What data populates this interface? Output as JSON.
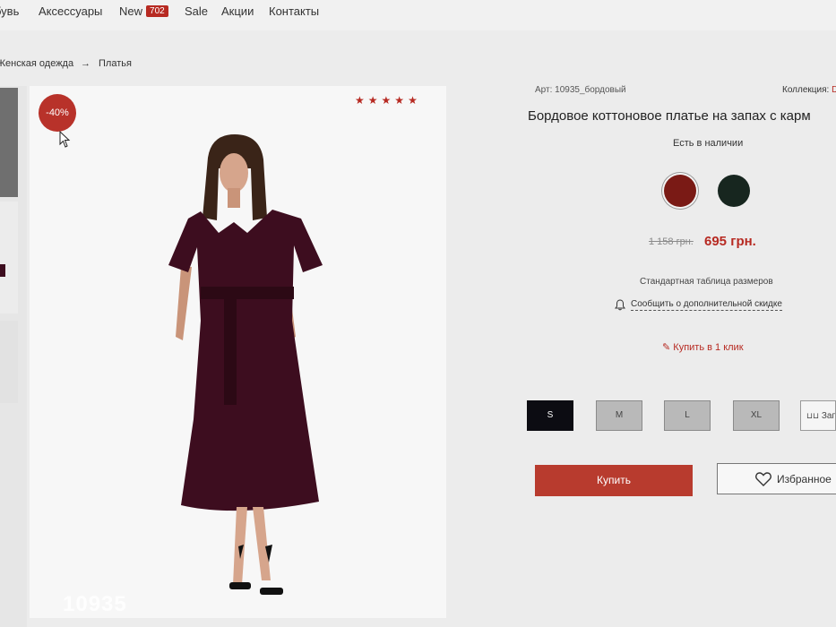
{
  "nav": {
    "items": [
      "бувь",
      "Аксессуары",
      "New",
      "Sale",
      "Акции",
      "Контакты"
    ],
    "new_badge": "702"
  },
  "breadcrumb": {
    "items": [
      "Женская одежда",
      "Платья"
    ],
    "separator": "→"
  },
  "gallery": {
    "discount": "-40%",
    "rating": 5,
    "watermark": "10935",
    "dress_color": "#3d0d1f"
  },
  "product": {
    "art": "Арт: 10935_бордовый",
    "collection_label": "Коллекция:",
    "collection_value": "D",
    "title": "Бордовое коттоновое платье на запах с карм",
    "stock": "Есть в наличии",
    "colors": [
      "#7a1a15",
      "#17261f"
    ],
    "old_price": "1 158 грн.",
    "price": "695 грн.",
    "size_table": "Стандартная таблица размеров",
    "notify": "Сообщить о дополнительной скидке",
    "one_click": "Купить в 1 клик",
    "sizes": [
      "S",
      "M",
      "L",
      "XL"
    ],
    "selected_size": "S",
    "size_extra": "Зап",
    "buy": "Купить",
    "favorite": "Избранное",
    "accent": "#b72a22"
  }
}
